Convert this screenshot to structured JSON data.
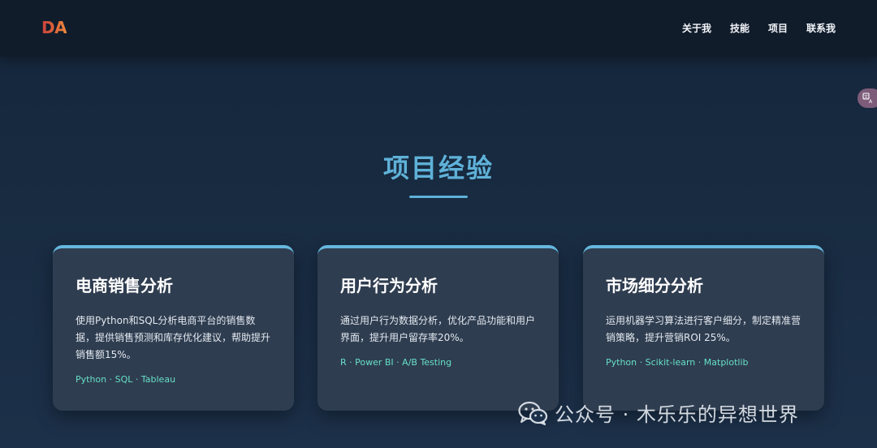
{
  "logo": "DA",
  "nav": [
    "关于我",
    "技能",
    "项目",
    "联系我"
  ],
  "section": {
    "title": "项目经验"
  },
  "projects": [
    {
      "title": "电商销售分析",
      "description": "使用Python和SQL分析电商平台的销售数据，提供销售预测和库存优化建议，帮助提升销售额15%。",
      "tech": "Python · SQL · Tableau"
    },
    {
      "title": "用户行为分析",
      "description": "通过用户行为数据分析，优化产品功能和用户界面，提升用户留存率20%。",
      "tech": "R · Power BI · A/B Testing"
    },
    {
      "title": "市场细分分析",
      "description": "运用机器学习算法进行客户细分，制定精准营销策略，提升营销ROI 25%。",
      "tech": "Python · Scikit-learn · Matplotlib"
    }
  ],
  "watermark": "公众号 · 木乐乐的异想世界",
  "colors": {
    "accent": "#5fb1d8",
    "tech": "#66e0c8",
    "card_bg": "#2f3d50",
    "nav_bg": "#111c2b"
  },
  "icons": {
    "translate": "translate-icon",
    "wechat": "wechat-icon"
  }
}
